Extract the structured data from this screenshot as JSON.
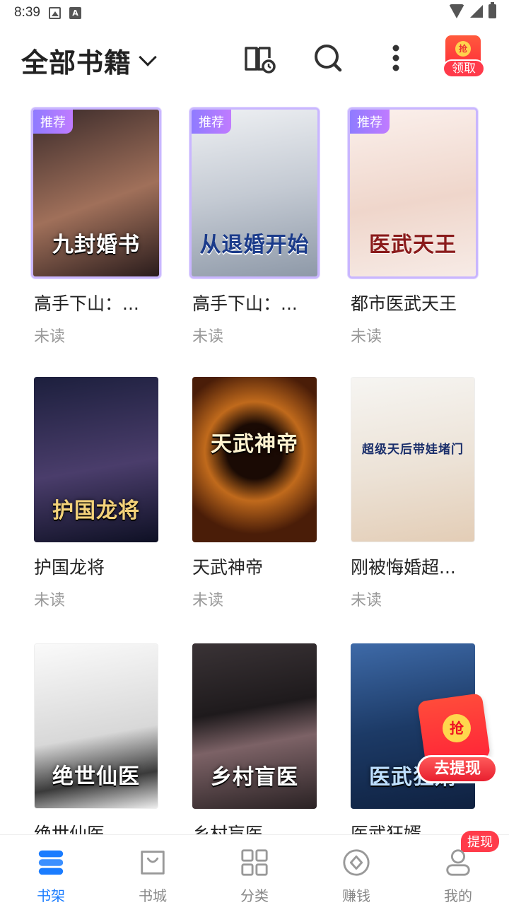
{
  "status_bar": {
    "time": "8:39"
  },
  "header": {
    "title": "全部书籍",
    "promo_label": "领取",
    "promo_coin": "抢"
  },
  "books": [
    {
      "name": "高手下山：...",
      "status": "未读",
      "tag": "推荐",
      "cover_title": "九封婚书",
      "colors": [
        "#3a2a2a",
        "#a0705a"
      ]
    },
    {
      "name": "高手下山：...",
      "status": "未读",
      "tag": "推荐",
      "cover_title": "从退婚开始",
      "colors": [
        "#d9dde4",
        "#9aa4b3"
      ]
    },
    {
      "name": "都市医武天王",
      "status": "未读",
      "tag": "推荐",
      "cover_title": "医武天王",
      "colors": [
        "#f7e6e2",
        "#e8c9bd"
      ]
    },
    {
      "name": "护国龙将",
      "status": "未读",
      "tag": "",
      "cover_title": "护国龙将",
      "colors": [
        "#1c1f3d",
        "#4a3d6b"
      ]
    },
    {
      "name": "天武神帝",
      "status": "未读",
      "tag": "",
      "cover_title": "天武神帝",
      "colors": [
        "#4a1d08",
        "#c06a1c"
      ]
    },
    {
      "name": "刚被悔婚超...",
      "status": "未读",
      "tag": "",
      "cover_title": "超级天后带娃堵门",
      "colors": [
        "#f2f0ec",
        "#e7d8c8"
      ]
    },
    {
      "name": "绝世仙医",
      "status": "",
      "tag": "",
      "cover_title": "绝世仙医",
      "colors": [
        "#f2f2f2",
        "#bcbcbc"
      ]
    },
    {
      "name": "乡村盲医",
      "status": "",
      "tag": "",
      "cover_title": "乡村盲医",
      "colors": [
        "#1e1a1c",
        "#5b4a4e"
      ]
    },
    {
      "name": "医武狂婿",
      "status": "",
      "tag": "",
      "cover_title": "医武狂婿",
      "colors": [
        "#1c3a66",
        "#5a7fb6"
      ]
    }
  ],
  "float_promo": {
    "label": "去提现",
    "coin": "抢"
  },
  "bottom_nav": {
    "items": [
      {
        "label": "书架",
        "icon": "bookshelf-icon",
        "active": true
      },
      {
        "label": "书城",
        "icon": "shopping-bag-icon",
        "active": false
      },
      {
        "label": "分类",
        "icon": "category-grid-icon",
        "active": false
      },
      {
        "label": "赚钱",
        "icon": "coin-icon",
        "active": false
      },
      {
        "label": "我的",
        "icon": "profile-icon",
        "active": false
      }
    ],
    "badge": "提现"
  },
  "colors": {
    "accent": "#1a7cff",
    "recommend_border": "#c9b6ff",
    "red": "#ff3b4a"
  }
}
